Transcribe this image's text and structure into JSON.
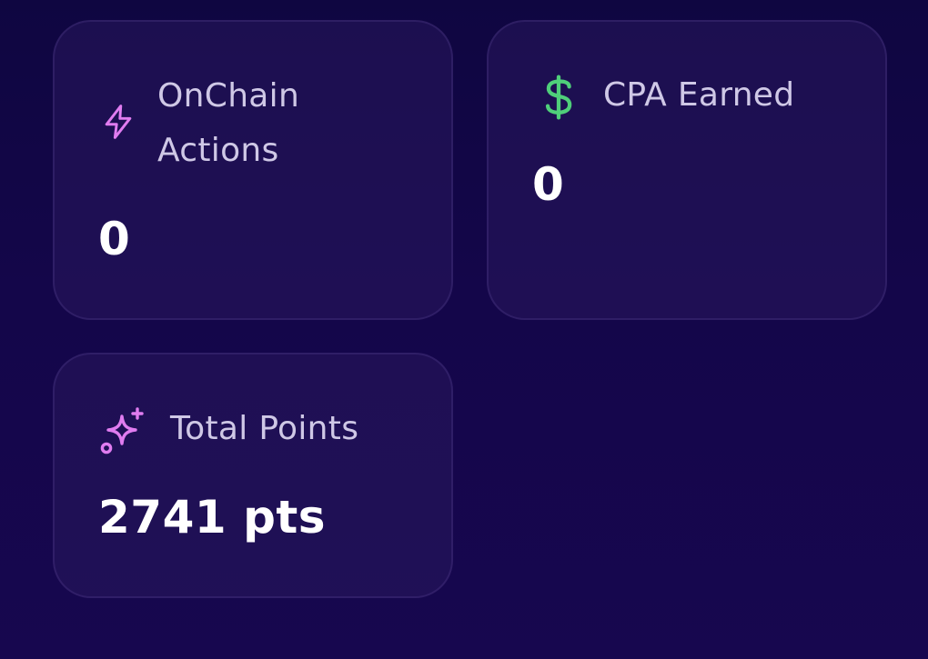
{
  "cards": {
    "onchain": {
      "icon": "lightning-icon",
      "label": "OnChain Actions",
      "value": "0"
    },
    "cpa": {
      "icon": "dollar-icon",
      "label": "CPA Earned",
      "value": "0"
    },
    "points": {
      "icon": "sparkles-icon",
      "label": "Total Points",
      "value": "2741 pts"
    }
  },
  "colors": {
    "background": "#120645",
    "card_background": "#1e1352",
    "label_text": "#cfc8e6",
    "value_text": "#ffffff",
    "lightning_icon": "#e07cf0",
    "dollar_icon": "#4fcf7a",
    "sparkles_icon": "#e07cf0"
  }
}
